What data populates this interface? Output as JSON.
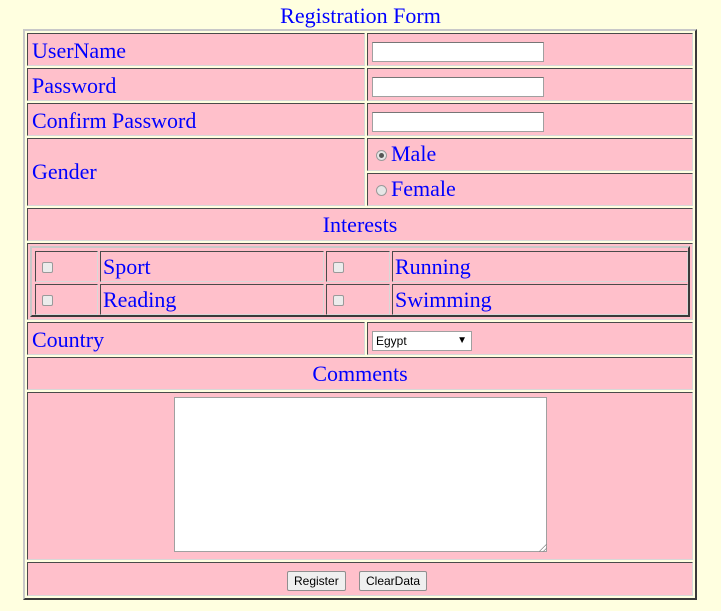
{
  "form": {
    "title": "Registration Form",
    "username_label": "UserName",
    "username_value": "",
    "password_label": "Password",
    "password_value": "",
    "confirm_label": "Confirm Password",
    "confirm_value": "",
    "gender_label": "Gender",
    "gender_options": [
      {
        "label": "Male",
        "checked": true
      },
      {
        "label": "Female",
        "checked": false
      }
    ],
    "interests_label": "Interests",
    "interests": [
      {
        "label": "Sport",
        "checked": false
      },
      {
        "label": "Running",
        "checked": false
      },
      {
        "label": "Reading",
        "checked": false
      },
      {
        "label": "Swimming",
        "checked": false
      }
    ],
    "country_label": "Country",
    "country_selected": "Egypt",
    "comments_label": "Comments",
    "comments_value": "",
    "register_label": "Register",
    "clear_label": "ClearData"
  },
  "colors": {
    "background": "#ffffe0",
    "cell": "#ffc0cb",
    "text": "#0000ff"
  },
  "icons": {
    "select_arrow": "chevron-down-icon",
    "resize": "resize-grip-icon"
  }
}
